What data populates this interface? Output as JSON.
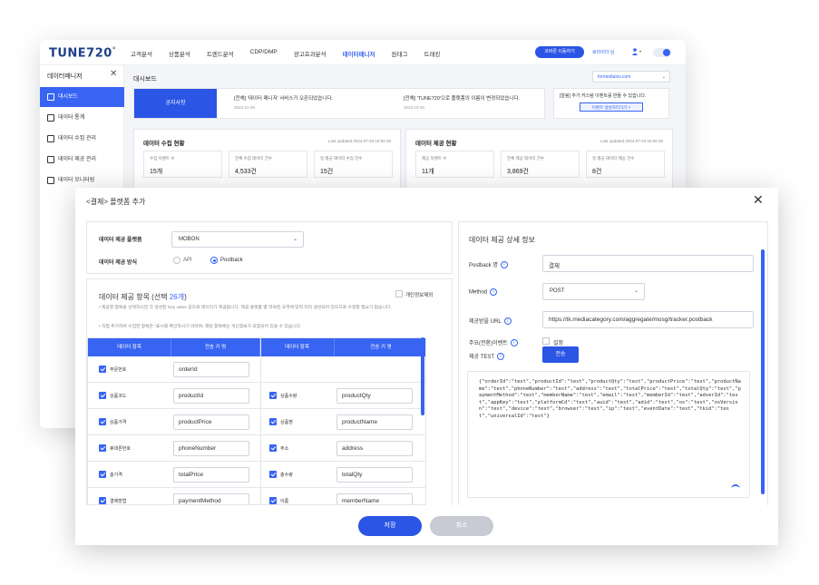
{
  "app": {
    "logo": "TUNE720",
    "logo_mark": "°",
    "nav": [
      "고객분석",
      "상품분석",
      "트렌드분석",
      "CDP/DMP",
      "광고효과분석",
      "데이터매니저",
      "원태그",
      "트래킹"
    ],
    "nav_active_index": 5,
    "top_button": "코바른 이동하기",
    "user_label": "로라이더 님"
  },
  "sidebar": {
    "title": "데이터매니저",
    "items": [
      "대시보드",
      "데이터 통계",
      "데이터 수집 관리",
      "데이터 제공 관리",
      "데이터 모니터링"
    ],
    "active_index": 0
  },
  "dashboard": {
    "title": "대시보드",
    "domain": "formedialov.com",
    "notice_label": "공지사항",
    "notices": [
      {
        "text": "[전체] '데이터 매니저' 서비스가 오픈되었습니다.",
        "date": "2023-10-30"
      },
      {
        "text": "[전체] 'TUNE720'으로 플랫폼의 이름이 변경되었습니다.",
        "date": "2023-10-30"
      }
    ],
    "alert_text": "[알림] 추가 커스텀 이벤트를 만들 수 있습니다.",
    "alert_button": "이벤트 생성하러가기 >",
    "collect": {
      "title": "데이터 수집 현황",
      "updated": "Last updated 2024-07-23 18:00:48",
      "cards": [
        {
          "label": "수집 이벤트 수",
          "value": "15개"
        },
        {
          "label": "전체 수집 데이터 건수",
          "value": "4,533건"
        },
        {
          "label": "일 평균 데이터 수집 건수",
          "value": "15건"
        }
      ]
    },
    "provide": {
      "title": "데이터 제공 현황",
      "updated": "Last updated 2024-07-23 18:00:48",
      "cards": [
        {
          "label": "제공 이벤트 수",
          "value": "11개"
        },
        {
          "label": "전체 제공 데이터 건수",
          "value": "3,869건"
        },
        {
          "label": "일 평균 데이터 제공 건수",
          "value": "8건"
        }
      ]
    }
  },
  "modal": {
    "title": "<결제> 플랫폼 추가",
    "platform_label": "데이터 제공 플랫폼",
    "platform_value": "MOBON",
    "method_label": "데이터 제공 방식",
    "method_options": [
      "API",
      "Postback"
    ],
    "method_selected": 1,
    "items_title_prefix": "데이터 제공 항목 (선택 ",
    "items_count": "26개",
    "items_title_suffix": ")",
    "privacy_label": "개인정보제외",
    "note1": "• 제공할 항목을 선택하시면 각 생성된 Key value 값으로 데이터가 제공됩니다. 제공 플랫폼 별 약속된 규격에 맞춰 미리 생성되어 있으므로 수정할 필요가 없습니다.",
    "note2": "• 직접 추가하여 수집한 항목은 \"표시를 확인하시기 바라며, 해당 항목에는 개인정보가 포함되어 있을 수 있습니다.",
    "table_headers": [
      "데이터 항목",
      "전송 키 명",
      "데이터 항목",
      "전송 키 명"
    ],
    "rows": [
      {
        "l_name": "주문번호",
        "l_key": "orderId",
        "r_name": "",
        "r_key": ""
      },
      {
        "l_name": "상품코드",
        "l_key": "productId",
        "r_name": "상품수량",
        "r_key": "productQty"
      },
      {
        "l_name": "상품가격",
        "l_key": "productPrice",
        "r_name": "상품명",
        "r_key": "productName"
      },
      {
        "l_name": "휴대폰번호",
        "l_key": "phoneNumber",
        "r_name": "주소",
        "r_key": "address"
      },
      {
        "l_name": "총가격",
        "l_key": "totalPrice",
        "r_name": "총수량",
        "r_key": "totalQty"
      },
      {
        "l_name": "결제방법",
        "l_key": "paymentMethod",
        "r_name": "이름",
        "r_key": "memberName"
      }
    ],
    "detail_title": "데이터 제공 상세 정보",
    "postback_label": "Postback 명",
    "postback_value": "결제",
    "http_label": "Method",
    "http_value": "POST",
    "url_label": "제공받을 URL",
    "url_value": "https://tk.mediacategory.com/aggregate/mosg/tracker.postback",
    "event_label": "주요(전환)이벤트",
    "event_check_label": "설정",
    "test_label": "제공 TEST",
    "test_button": "전송",
    "json_body": "{\"orderId\":\"test\",\"productId\":\"test\",\"productQty\":\"test\",\"productPrice\":\"test\",\"productName\":\"test\",\"phoneNumber\":\"test\",\"address\":\"test\",\"totalPrice\":\"test\",\"totalQty\":\"test\",\"paymentMethod\":\"test\",\"memberName\":\"test\",\"email\":\"test\",\"memberId\":\"test\",\"adverId\":\"test\",\"appKey\":\"test\",\"platformCd\":\"test\",\"auid\":\"test\",\"adid\":\"test\",\"os\":\"test\",\"osVersion\":\"test\",\"device\":\"test\",\"browser\":\"test\",\"ip\":\"test\",\"eventDate\":\"test\",\"tkid\":\"test\",\"universalId\":\"test\"}",
    "save_label": "저장",
    "cancel_label": "취소"
  },
  "colors": {
    "accent": "#3764f2",
    "button": "#2a55e5",
    "disabled": "#c8cbd3"
  }
}
